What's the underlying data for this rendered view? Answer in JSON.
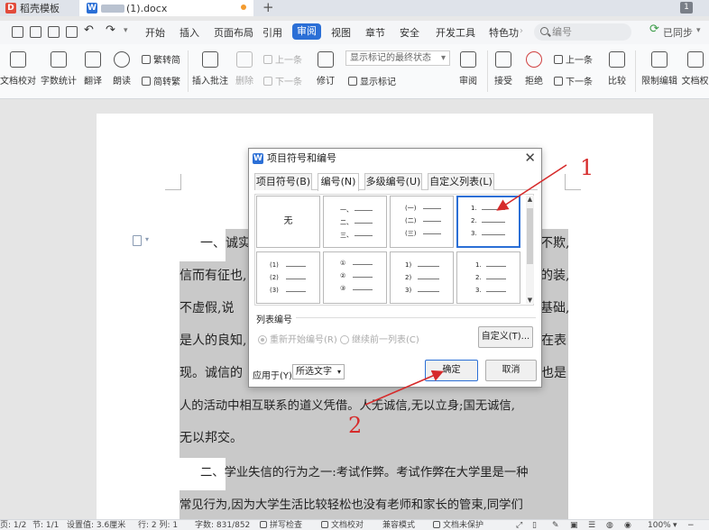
{
  "tabs": [
    {
      "label": "稻壳模板",
      "logo": "W"
    },
    {
      "label": "(1).docx",
      "logo": "W"
    }
  ],
  "menu": {
    "items": [
      "开始",
      "插入",
      "页面布局",
      "引用",
      "审阅",
      "视图",
      "章节",
      "安全",
      "开发工具",
      "特色功"
    ],
    "active": "审阅",
    "search_placeholder": "编号",
    "sync_label": "已同步"
  },
  "ribbon": {
    "doc_proof": "文档校对",
    "word_count": "字数统计",
    "translate": "翻译",
    "read_aloud": "朗读",
    "trad_to_simp": "繁转简",
    "simp_to_trad": "简转繁",
    "insert_comment": "插入批注",
    "delete": "删除",
    "prev_comment": "上一条",
    "next_comment": "下一条",
    "revise": "修订",
    "show_state": "显示标记的最终状态",
    "show_markup": "显示标记",
    "review": "审阅",
    "accept": "接受",
    "reject": "拒绝",
    "prev_change": "上一条",
    "next_change": "下一条",
    "compare": "比较",
    "restrict_edit": "限制编辑",
    "doc_perm": "文档权"
  },
  "document": {
    "lines": [
      "一、诚实",
      "不欺,",
      "信而有征也,",
      "的装,",
      "不虚假,说",
      "基础,",
      "是人的良知,",
      "在表",
      "现。诚信的",
      "也是",
      "人的活动中相互联系的道义凭借。人无诚信,无以立身;国无诚信,",
      "无以邦交。",
      "二、学业失信的行为之一:考试作弊。考试作弊在大学里是一种",
      "常见行为,因为大学生活比较轻松也没有老师和家长的管束,同学们"
    ]
  },
  "dialog": {
    "title": "项目符号和编号",
    "tabs": [
      "项目符号(B)",
      "编号(N)",
      "多级编号(U)",
      "自定义列表(L)"
    ],
    "active_tab": "编号(N)",
    "none_label": "无",
    "gallery": [
      {
        "style": "none"
      },
      {
        "style": "chinese",
        "items": [
          "一、",
          "二、",
          "三、"
        ]
      },
      {
        "style": "chinese-paren",
        "items": [
          "(一)",
          "(二)",
          "(三)"
        ]
      },
      {
        "style": "arabic-dot",
        "items": [
          "1.",
          "2.",
          "3."
        ],
        "selected": true
      },
      {
        "style": "arabic-paren",
        "items": [
          "(1)",
          "(2)",
          "(3)"
        ]
      },
      {
        "style": "circled",
        "items": [
          "①",
          "②",
          "③"
        ]
      },
      {
        "style": "arabic-rparen",
        "items": [
          "1)",
          "2)",
          "3)"
        ]
      },
      {
        "style": "arabic-dot-2",
        "items": [
          "1.",
          "2.",
          "3."
        ]
      }
    ],
    "section_label": "列表编号",
    "restart_label": "重新开始编号(R)",
    "continue_label": "继续前一列表(C)",
    "custom_button": "自定义(T)...",
    "apply_label": "应用于(Y):",
    "apply_value": "所选文字",
    "ok_button": "确定",
    "cancel_button": "取消"
  },
  "annotations": [
    "1",
    "2"
  ],
  "statusbar": {
    "page": "页: 1/2",
    "section": "节: 1/1",
    "setting": "设置值: 3.6厘米",
    "rowcol": "行: 2  列: 1",
    "wordcount": "字数: 831/852",
    "spell": "拼写检查",
    "proof": "文档校对",
    "compat": "兼容模式",
    "unprotected": "文档未保护",
    "zoom": "100%"
  },
  "colors": {
    "accent": "#2b6fd6",
    "annotation": "#d62b2b",
    "highlight": "#c9c9c9"
  }
}
